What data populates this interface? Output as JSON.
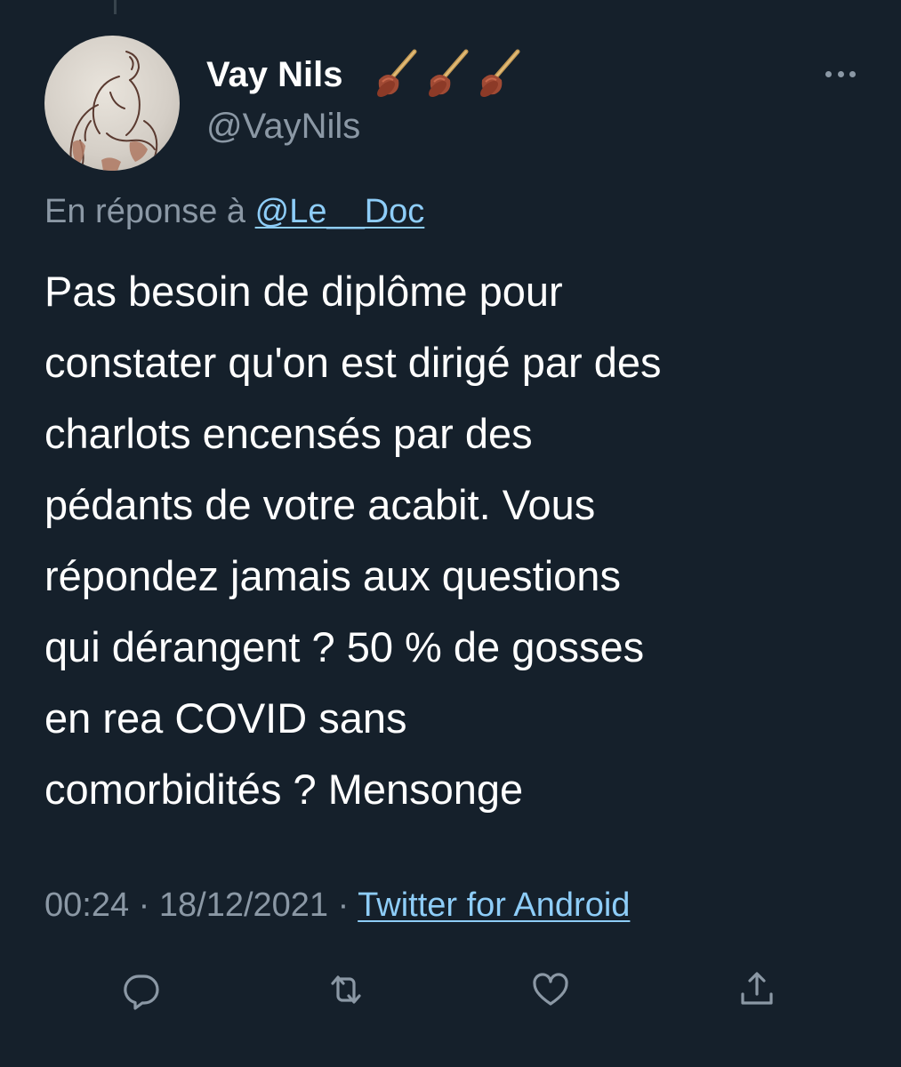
{
  "tweet": {
    "author": {
      "display_name": "Vay Nils",
      "name_emoji": [
        "plunger-emoji",
        "plunger-emoji",
        "plunger-emoji"
      ],
      "handle": "@VayNils"
    },
    "reply": {
      "prefix": "En réponse à",
      "mention": "@Le__Doc"
    },
    "text": "Pas besoin de diplôme pour\nconstater qu'on est dirigé par des\ncharlots encensés par des\npédants de votre acabit. Vous\nrépondez jamais aux questions\nqui dérangent ? 50 % de gosses\nen rea COVID sans\ncomorbidités ? Mensonge",
    "time": "00:24",
    "separator": "·",
    "date": "18/12/2021",
    "source": "Twitter for Android",
    "actions": [
      "reply-icon",
      "retweet-icon",
      "like-icon",
      "share-icon"
    ]
  },
  "colors": {
    "background": "#15202b",
    "text": "#ffffff",
    "muted": "#8b98a5",
    "link": "#8ecdf8"
  }
}
